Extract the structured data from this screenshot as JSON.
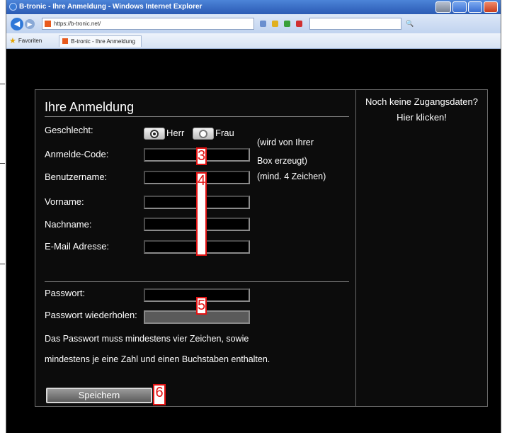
{
  "browser": {
    "window_title": "B-tronic - Ihre Anmeldung - Windows Internet Explorer",
    "url": "https://b-tronic.net/",
    "favorites_label": "Favoriten",
    "tab_label": "B-tronic - Ihre Anmeldung"
  },
  "form": {
    "title": "Ihre Anmeldung",
    "gender_label": "Geschlecht:",
    "radio_herr": "Herr",
    "radio_frau": "Frau",
    "anmelde_code_label": "Anmelde-Code:",
    "anmelde_code_hint_1": "(wird von Ihrer",
    "anmelde_code_hint_2": "Box erzeugt)",
    "benutzername_label": "Benutzername:",
    "benutzername_hint": "(mind. 4 Zeichen)",
    "vorname_label": "Vorname:",
    "nachname_label": "Nachname:",
    "email_label": "E-Mail Adresse:",
    "passwort_label": "Passwort:",
    "passwort_repeat_label": "Passwort wiederholen:",
    "password_rule_1": "Das Passwort muss mindestens vier Zeichen, sowie",
    "password_rule_2": "mindestens je eine Zahl und einen Buchstaben enthalten.",
    "save_button": "Speichern"
  },
  "side": {
    "line_1": "Noch keine Zugangsdaten?",
    "line_2": "Hier klicken!"
  },
  "markers": {
    "m3": "3",
    "m4": "4",
    "m5": "5",
    "m6": "6"
  },
  "colors": {
    "page_background": "#000000",
    "marker_red": "#e21313",
    "titlebar_blue": "#2b5bb4"
  }
}
